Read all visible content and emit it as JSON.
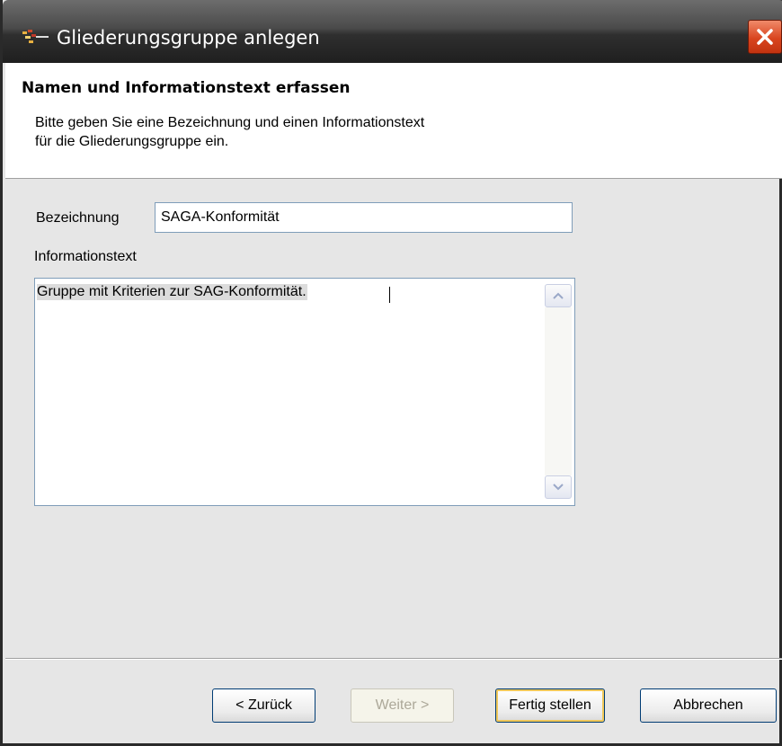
{
  "window": {
    "title": "Gliederungsgruppe anlegen",
    "app_icon": "app-logo-icon",
    "close_icon": "close-icon"
  },
  "header": {
    "title": "Namen und Informationstext erfassen",
    "description_line1": "Bitte geben Sie eine Bezeichnung und einen Informationstext",
    "description_line2": "für die Gliederungsgruppe ein."
  },
  "form": {
    "bezeichnung_label": "Bezeichnung",
    "bezeichnung_value": "SAGA-Konformität",
    "informationstext_label": "Informationstext",
    "informationstext_value": "Gruppe mit Kriterien zur SAG-Konformität."
  },
  "buttons": {
    "back_label": "< Zurück",
    "next_label": "Weiter >",
    "finish_label": "Fertig stellen",
    "cancel_label": "Abbrechen"
  },
  "colors": {
    "title_bar": "#2f2f2f",
    "close_button": "#d9451f",
    "dialog_background": "#e6e6e6",
    "input_border": "#7f9db9"
  }
}
